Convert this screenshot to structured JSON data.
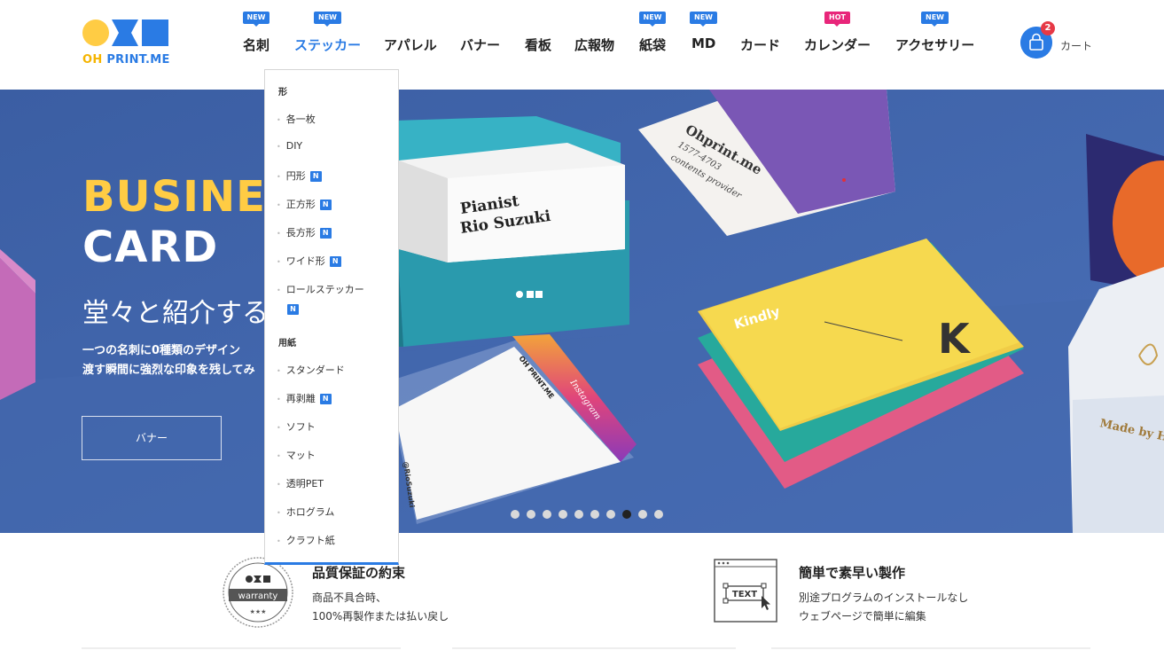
{
  "header": {
    "logo": {
      "text_oh": "OH",
      "text_print": " PRINT.ME"
    },
    "nav": [
      {
        "label": "名刺",
        "badge": "NEW",
        "badge_type": "new",
        "active": false
      },
      {
        "label": "ステッカー",
        "badge": "NEW",
        "badge_type": "new",
        "active": true
      },
      {
        "label": "アパレル",
        "badge": "",
        "badge_type": "",
        "active": false
      },
      {
        "label": "バナー",
        "badge": "",
        "badge_type": "",
        "active": false
      },
      {
        "label": "看板",
        "badge": "",
        "badge_type": "",
        "active": false
      },
      {
        "label": "広報物",
        "badge": "",
        "badge_type": "",
        "active": false
      },
      {
        "label": "紙袋",
        "badge": "NEW",
        "badge_type": "new",
        "active": false
      },
      {
        "label": "MD",
        "badge": "NEW",
        "badge_type": "new",
        "active": false
      },
      {
        "label": "カード",
        "badge": "",
        "badge_type": "",
        "active": false
      },
      {
        "label": "カレンダー",
        "badge": "HOT",
        "badge_type": "hot",
        "active": false
      },
      {
        "label": "アクセサリー",
        "badge": "NEW",
        "badge_type": "new",
        "active": false
      }
    ],
    "cart": {
      "count": "2",
      "label": "カート",
      "icon": "shopping-bag-icon"
    }
  },
  "dropdown": {
    "sections": [
      {
        "title": "形",
        "items": [
          {
            "label": "各一枚",
            "new": false
          },
          {
            "label": "DIY",
            "new": false
          },
          {
            "label": "円形",
            "new": true
          },
          {
            "label": "正方形",
            "new": true
          },
          {
            "label": "長方形",
            "new": true
          },
          {
            "label": "ワイド形",
            "new": true
          },
          {
            "label": "ロールステッカー",
            "new": true
          }
        ]
      },
      {
        "title": "用紙",
        "items": [
          {
            "label": "スタンダード",
            "new": false
          },
          {
            "label": "再剥離",
            "new": true
          },
          {
            "label": "ソフト",
            "new": false
          },
          {
            "label": "マット",
            "new": false
          },
          {
            "label": "透明PET",
            "new": false
          },
          {
            "label": "ホログラム",
            "new": false
          },
          {
            "label": "クラフト紙",
            "new": false
          }
        ]
      }
    ],
    "new_badge": "N"
  },
  "hero": {
    "title_line1": "BUSINESS",
    "title_line2": "CARD",
    "subtitle": "堂々と紹介するカード",
    "desc_line1": "一つの名刺に0種類のデザイン",
    "desc_line2": "渡す瞬間に強烈な印象を残してみ",
    "button": "バナー",
    "slides_total": 10,
    "slide_active": 8,
    "card_texts": {
      "pianist": "Pianist",
      "name": "Rio Suzuki",
      "brand": "Ohprint.me",
      "phone": "1577-4703",
      "tagline": "contents provider",
      "kindly": "Kindly",
      "k": "K",
      "instagram": "Instagram",
      "ohprint": "OH PRINT.ME",
      "handle": "@RioSuzuki",
      "made_by": "Made by H"
    }
  },
  "features": [
    {
      "icon": "warranty-badge-icon",
      "badge_text": "warranty",
      "stars": "★★★",
      "title": "品質保証の約束",
      "desc1": "商品不具合時、",
      "desc2": "100%再製作または払い戻し"
    },
    {
      "icon": "text-editor-icon",
      "badge_text": "TEXT",
      "title": "簡単で素早い製作",
      "desc1": "別途プログラムのインストールなし",
      "desc2": "ウェブページで簡単に編集"
    }
  ],
  "colors": {
    "brand_blue": "#2a7be4",
    "brand_yellow": "#ffcc44",
    "hot_pink": "#e8267a",
    "hero_bg": "#3f64a8"
  }
}
